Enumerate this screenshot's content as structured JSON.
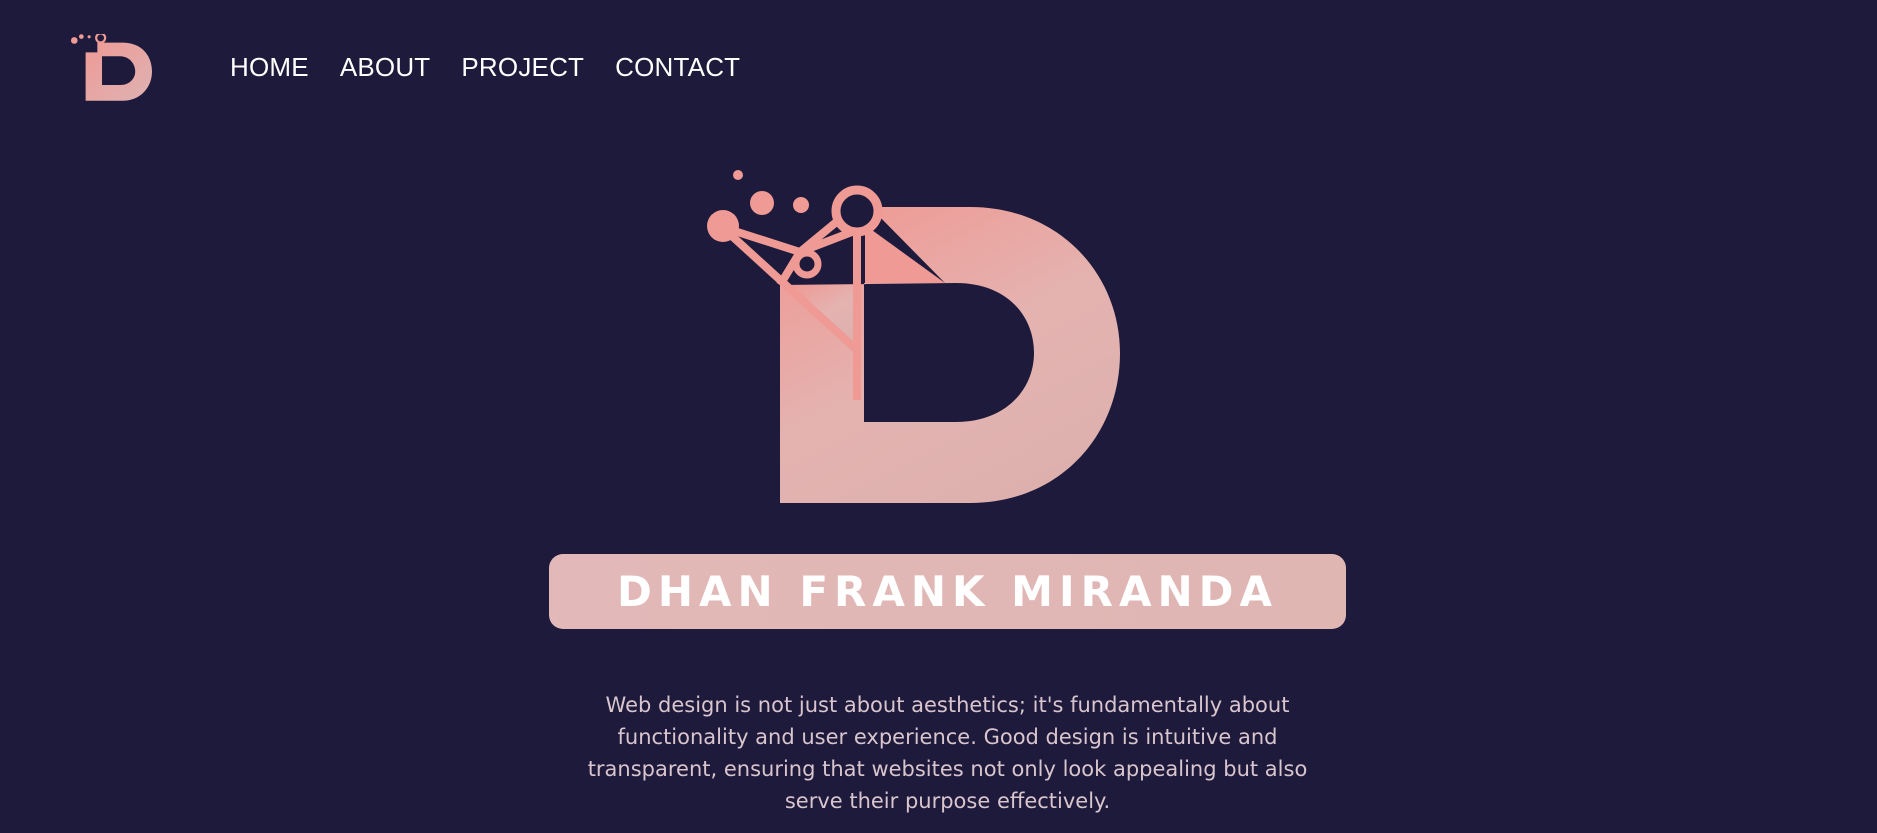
{
  "nav": {
    "logo_icon": "d-logo-icon",
    "links": [
      {
        "label": "HOME"
      },
      {
        "label": "ABOUT"
      },
      {
        "label": "PROJECT"
      },
      {
        "label": "CONTACT"
      }
    ]
  },
  "hero": {
    "logo_icon": "d-logo-icon",
    "name": "DHAN FRANK MIRANDA",
    "tagline": "Web design is not just about aesthetics; it's fundamentally about functionality and user experience. Good design is intuitive and transparent, ensuring that websites not only look appealing but also serve their purpose effectively."
  },
  "colors": {
    "background": "#1e1a3b",
    "accent_pink": "#ef9a95",
    "accent_light": "#e2b8b8",
    "tagline_text": "#d9c5cd"
  }
}
